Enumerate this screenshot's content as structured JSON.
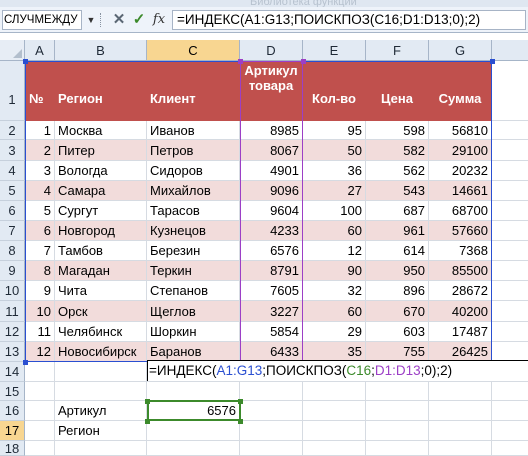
{
  "ribbon_hint": "Библиотека функций",
  "name_box": "СЛУЧМЕЖДУ",
  "formula_bar": {
    "fx_label": "fx",
    "formula": "=ИНДЕКС(A1:G13;ПОИСКПОЗ(C16;D1:D13;0);2)"
  },
  "columns": [
    "A",
    "B",
    "C",
    "D",
    "E",
    "F",
    "G"
  ],
  "rows": [
    "1",
    "2",
    "3",
    "4",
    "5",
    "6",
    "7",
    "8",
    "9",
    "10",
    "11",
    "12",
    "13",
    "14",
    "15",
    "16",
    "17",
    "18"
  ],
  "table": {
    "headers": [
      "№",
      "Регион",
      "Клиент",
      "Артикул товара",
      "Кол-во",
      "Цена",
      "Сумма"
    ],
    "header_d": [
      "Артикул",
      "товара"
    ],
    "data": [
      [
        "1",
        "Москва",
        "Иванов",
        "8985",
        "95",
        "598",
        "56810"
      ],
      [
        "2",
        "Питер",
        "Петров",
        "8067",
        "50",
        "582",
        "29100"
      ],
      [
        "3",
        "Вологда",
        "Сидоров",
        "4901",
        "36",
        "562",
        "20232"
      ],
      [
        "4",
        "Самара",
        "Михайлов",
        "9096",
        "27",
        "543",
        "14661"
      ],
      [
        "5",
        "Сургут",
        "Тарасов",
        "9604",
        "100",
        "687",
        "68700"
      ],
      [
        "6",
        "Новгород",
        "Кузнецов",
        "4233",
        "60",
        "961",
        "57660"
      ],
      [
        "7",
        "Тамбов",
        "Березин",
        "6576",
        "12",
        "614",
        "7368"
      ],
      [
        "8",
        "Магадан",
        "Теркин",
        "8791",
        "90",
        "950",
        "85500"
      ],
      [
        "9",
        "Чита",
        "Степанов",
        "7605",
        "32",
        "896",
        "28672"
      ],
      [
        "10",
        "Орск",
        "Щеглов",
        "3227",
        "60",
        "670",
        "40200"
      ],
      [
        "11",
        "Челябинск",
        "Шоркин",
        "5854",
        "29",
        "603",
        "17487"
      ],
      [
        "12",
        "Новосибирск",
        "Баранов",
        "6433",
        "35",
        "755",
        "26425"
      ]
    ]
  },
  "lookup": {
    "label_article": "Артикул",
    "value_article": "6576",
    "label_region": "Регион",
    "edit_formula": {
      "p1": "=ИНДЕКС(",
      "p2": "A1:G13",
      "p3": ";ПОИСКПОЗ(",
      "p4": "C16",
      "p5": ";",
      "p6": "D1:D13",
      "p7": ";0);2)"
    }
  },
  "colors": {
    "header_fill": "#c0504d",
    "band_fill": "#f2dcdb",
    "range_blue": "#2a4fd1",
    "range_green": "#3c8a2b",
    "range_purple": "#9c3fc6"
  }
}
